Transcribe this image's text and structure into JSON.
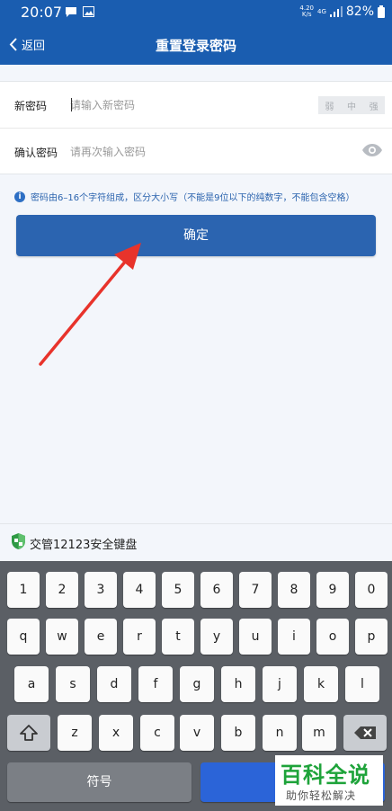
{
  "status_bar": {
    "time": "20:07",
    "net_speed_top": "4.20",
    "net_speed_bottom": "K/s",
    "network": "4G",
    "battery": "82%"
  },
  "header": {
    "back_label": "返回",
    "title": "重置登录密码"
  },
  "form": {
    "new_password_label": "新密码",
    "new_password_placeholder": "请输入新密码",
    "new_password_value": "",
    "strength_levels": [
      "弱",
      "中",
      "强"
    ],
    "confirm_password_label": "确认密码",
    "confirm_password_placeholder": "请再次输入密码",
    "confirm_password_value": ""
  },
  "hint": {
    "text": "密码由6–16个字符组成，区分大小写（不能是9位以下的纯数字，不能包含空格）"
  },
  "confirm_button": {
    "label": "确定"
  },
  "keyboard": {
    "title": "交管12123安全键盘",
    "row_numbers": [
      "1",
      "2",
      "3",
      "4",
      "5",
      "6",
      "7",
      "8",
      "9",
      "0"
    ],
    "row_top": [
      "q",
      "w",
      "e",
      "r",
      "t",
      "y",
      "u",
      "i",
      "o",
      "p"
    ],
    "row_middle": [
      "a",
      "s",
      "d",
      "f",
      "g",
      "h",
      "j",
      "k",
      "l"
    ],
    "row_bottom": [
      "z",
      "x",
      "c",
      "v",
      "b",
      "n",
      "m"
    ],
    "symbols_label": "符号"
  },
  "watermark": {
    "brand": "百科全说",
    "slogan": "助你轻松解决"
  },
  "colors": {
    "header_bg": "#1a5db0",
    "button_bg": "#2b64b0",
    "arrow": "#e8332b",
    "watermark_green": "#1ea33a"
  }
}
